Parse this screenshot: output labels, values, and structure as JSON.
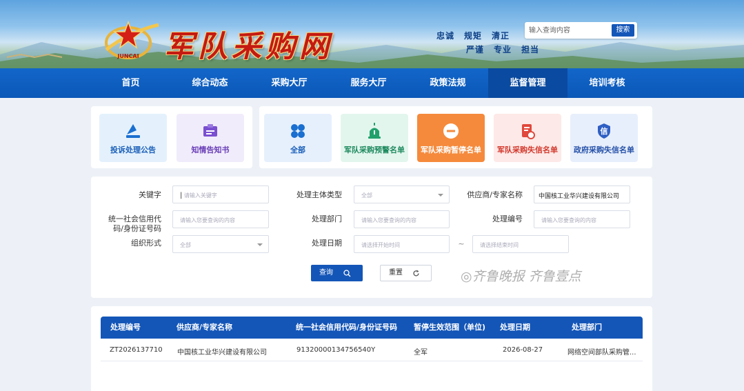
{
  "header": {
    "site_title": "军队采购网",
    "logo_text": "JUNCAI",
    "slogans": [
      "忠诚",
      "规矩",
      "清正",
      "严谨",
      "专业",
      "担当"
    ],
    "search_placeholder": "输入查询内容",
    "search_button": "搜索"
  },
  "nav": {
    "items": [
      "首页",
      "综合动态",
      "采购大厅",
      "服务大厅",
      "政策法规",
      "监督管理",
      "培训考核"
    ],
    "active": "监督管理"
  },
  "quick_left": [
    "投诉处理公告",
    "知情告知书"
  ],
  "quick_right": [
    "全部",
    "军队采购预警名单",
    "军队采购暂停名单",
    "军队采购失信名单",
    "政府采购失信名单"
  ],
  "form": {
    "keyword_label": "关键字",
    "keyword_placeholder": "请输入关键字",
    "subject_type_label": "处理主体类型",
    "subject_type_value": "全部",
    "supplier_label": "供应商/专家名称",
    "supplier_value": "中国核工业华兴建设有限公司",
    "credit_label_1": "统一社会信用代",
    "credit_label_2": "码/身份证号码",
    "credit_placeholder": "请输入您要查询的内容",
    "dept_label": "处理部门",
    "dept_placeholder": "请输入您要查询的内容",
    "number_label": "处理编号",
    "number_placeholder": "请输入您要查询的内容",
    "org_form_label": "组织形式",
    "org_form_value": "全部",
    "date_label": "处理日期",
    "date_start_placeholder": "请选择开始时间",
    "date_sep": "~",
    "date_end_placeholder": "请选择结束时间",
    "query_button": "查询",
    "reset_button": "重置"
  },
  "watermark": "◎齐鲁晚报  齐鲁壹点",
  "table": {
    "headers": [
      "处理编号",
      "供应商/专家名称",
      "统一社会信用代码/身份证号码",
      "暂停生效范围（单位)",
      "处理日期",
      "处理部门"
    ],
    "rows": [
      [
        "ZT2026137710",
        "中国核工业华兴建设有限公司",
        "91320000134756540Y",
        "全军",
        "2026-08-27",
        "网络空间部队采购管..."
      ]
    ]
  },
  "colors": {
    "primary": "#1456b8",
    "nav_active": "#0a4aa0",
    "active_card": "#f58a3c",
    "title_red": "#c41a12"
  }
}
